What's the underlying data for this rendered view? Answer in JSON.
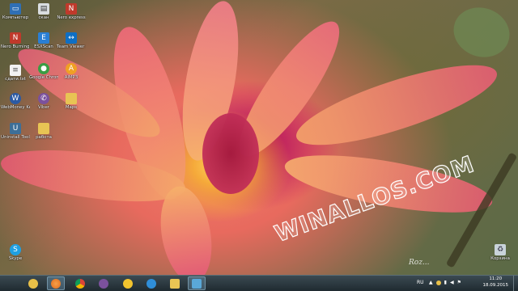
{
  "desktop_icons": [
    {
      "label": "Компьютер",
      "icon": "computer-icon",
      "color": "#2f6fb5"
    },
    {
      "label": "скан",
      "icon": "scanner-icon",
      "color": "#d9dde0"
    },
    {
      "label": "Nero express",
      "icon": "nero-express-icon",
      "color": "#c0392b"
    },
    {
      "label": "Nero Burning ROM",
      "icon": "nero-burning-rom-icon",
      "color": "#c0392b"
    },
    {
      "label": "ESXScan",
      "icon": "esxscan-icon",
      "color": "#2a7fd4"
    },
    {
      "label": "Team Viewer 10",
      "icon": "teamviewer-icon",
      "color": "#0e6fc5"
    },
    {
      "label": "сдати.txt",
      "icon": "text-file-icon",
      "color": "#f2f2f2"
    },
    {
      "label": "Google Chrome",
      "icon": "chrome-icon",
      "color": "#3a9d44"
    },
    {
      "label": "AIMP3",
      "icon": "aimp-icon",
      "color": "#f0a024"
    },
    {
      "label": "WebMoney Keeper W...",
      "icon": "webmoney-icon",
      "color": "#2b5aa3"
    },
    {
      "label": "Viber",
      "icon": "viber-icon",
      "color": "#7b519d"
    },
    {
      "label": "Maps",
      "icon": "folder-icon",
      "color": "#e8c454"
    },
    {
      "label": "Uninstall Tool",
      "icon": "uninstall-tool-icon",
      "color": "#3d6f98"
    },
    {
      "label": "работа",
      "icon": "folder-icon",
      "color": "#e8c454"
    },
    {
      "label": "Skype",
      "icon": "skype-icon",
      "color": "#1fa0e3"
    },
    {
      "label": "Корзина",
      "icon": "recycle-bin-icon",
      "color": "#c9d3da"
    }
  ],
  "watermark": "WINALLOS.COM",
  "signature": "Roz...",
  "taskbar": {
    "apps": [
      {
        "name": "start",
        "icon": "start-orb-icon",
        "color": "#e8c048"
      },
      {
        "name": "firefox",
        "icon": "firefox-icon",
        "color": "#e06a1b"
      },
      {
        "name": "chrome",
        "icon": "chrome-icon",
        "color": "#3a9d44"
      },
      {
        "name": "viber",
        "icon": "viber-icon",
        "color": "#7b519d"
      },
      {
        "name": "smiley",
        "icon": "smiley-icon",
        "color": "#f2c42e"
      },
      {
        "name": "ie",
        "icon": "internet-explorer-icon",
        "color": "#2f8ed8"
      },
      {
        "name": "explorer",
        "icon": "folder-icon",
        "color": "#e8c454"
      },
      {
        "name": "remote",
        "icon": "remote-desktop-icon",
        "color": "#5aa8d8"
      }
    ],
    "language": "RU",
    "time": "11:20",
    "date": "18.09.2015"
  }
}
